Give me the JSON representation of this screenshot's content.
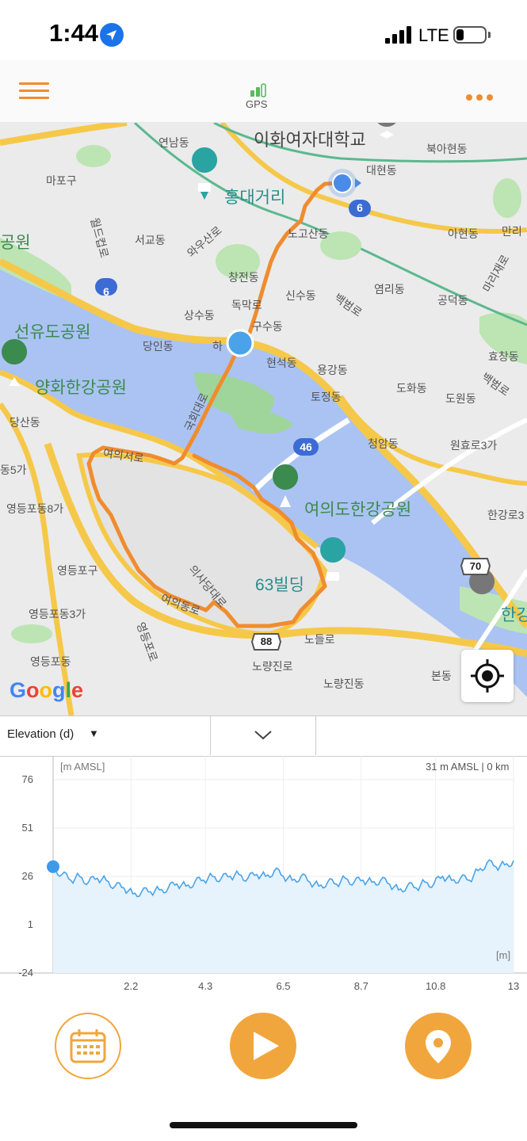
{
  "status_bar": {
    "time": "1:44",
    "network": "LTE",
    "icons": [
      "location-arrow-icon",
      "signal-icon",
      "battery-icon"
    ]
  },
  "toolbar": {
    "gps_label": "GPS",
    "icons": [
      "hamburger-menu-icon",
      "gps-signal-icon",
      "more-options-icon"
    ]
  },
  "map": {
    "labels": [
      {
        "id": "yeonhui",
        "text": "연남동"
      },
      {
        "id": "ewha",
        "text": "이화여자대학교"
      },
      {
        "id": "bukahyeon",
        "text": "북아현동"
      },
      {
        "id": "mapogu",
        "text": "마포구"
      },
      {
        "id": "hongdae",
        "text": "홍대거리"
      },
      {
        "id": "daehyeon",
        "text": "대현동"
      },
      {
        "id": "park1",
        "text": "공원"
      },
      {
        "id": "seogyo",
        "text": "서교동"
      },
      {
        "id": "wausan",
        "text": "와우산로"
      },
      {
        "id": "nogosan",
        "text": "노고산동"
      },
      {
        "id": "ahyeon",
        "text": "아현동"
      },
      {
        "id": "malli",
        "text": "만리"
      },
      {
        "id": "worldcup",
        "text": "월드컵로"
      },
      {
        "id": "changjeon",
        "text": "창전동"
      },
      {
        "id": "yeomni",
        "text": "염리동"
      },
      {
        "id": "mallijae",
        "text": "마리재로"
      },
      {
        "id": "sinsu",
        "text": "신수동"
      },
      {
        "id": "baekbeom1",
        "text": "백범로"
      },
      {
        "id": "gongdeok",
        "text": "공덕동"
      },
      {
        "id": "dongmak",
        "text": "독막로"
      },
      {
        "id": "sangsu",
        "text": "상수동"
      },
      {
        "id": "seonyudo",
        "text": "선유도공원"
      },
      {
        "id": "gusu",
        "text": "구수동"
      },
      {
        "id": "danginro",
        "text": "당인동"
      },
      {
        "id": "ha",
        "text": "하"
      },
      {
        "id": "hyoseok",
        "text": "현석동"
      },
      {
        "id": "yonggang",
        "text": "용강동"
      },
      {
        "id": "hyochang",
        "text": "효창동"
      },
      {
        "id": "yanghwa",
        "text": "양화한강공원"
      },
      {
        "id": "baekbeom2",
        "text": "백범로"
      },
      {
        "id": "tojeong",
        "text": "토정동"
      },
      {
        "id": "dohwa",
        "text": "도화동"
      },
      {
        "id": "dangsan",
        "text": "당산동"
      },
      {
        "id": "gukhoe",
        "text": "국회대로"
      },
      {
        "id": "dowon",
        "text": "도원동"
      },
      {
        "id": "cheongam",
        "text": "청암동"
      },
      {
        "id": "yeouiseo",
        "text": "여의서로"
      },
      {
        "id": "wonhyo",
        "text": "원효로3가"
      },
      {
        "id": "dong5",
        "text": "동5가"
      },
      {
        "id": "yeouido",
        "text": "여의도한강공원"
      },
      {
        "id": "yeongdeungpo8",
        "text": "영등포동8가"
      },
      {
        "id": "hanggang3",
        "text": "한강로3"
      },
      {
        "id": "yeongdeungpogu",
        "text": "영등포구"
      },
      {
        "id": "uisadang",
        "text": "의사당대로"
      },
      {
        "id": "63bldg",
        "text": "63빌딩"
      },
      {
        "id": "yeouidongro",
        "text": "여의동로"
      },
      {
        "id": "yeongdeungpo3",
        "text": "영등포동3가"
      },
      {
        "id": "hanggang",
        "text": "한강"
      },
      {
        "id": "yeongdeungporo",
        "text": "영등포로"
      },
      {
        "id": "nodeulro",
        "text": "노들로"
      },
      {
        "id": "yeongdeungpodong",
        "text": "영등포동"
      },
      {
        "id": "noryangjinro",
        "text": "노량진로"
      },
      {
        "id": "bondong",
        "text": "본동"
      },
      {
        "id": "noryangjin",
        "text": "노량진동"
      }
    ],
    "route_badges": [
      "6",
      "6",
      "46",
      "70",
      "88"
    ],
    "google_logo": "Google",
    "route_color": "#f08c2e"
  },
  "selector": {
    "label": "Elevation (d)",
    "dropdown_icon": "▼"
  },
  "chart_data": {
    "type": "area",
    "y_unit_label": "[m AMSL]",
    "x_unit_label": "[m]",
    "current_readout": "31 m AMSL | 0 km",
    "yticks": [
      "76",
      "51",
      "26",
      "1",
      "-24"
    ],
    "xticks": [
      "2.2",
      "4.3",
      "6.5",
      "8.7",
      "10.8",
      "13"
    ],
    "ylim": [
      -24,
      76
    ],
    "xlim": [
      0,
      13
    ],
    "x": [
      0,
      0.25,
      0.5,
      0.75,
      1.0,
      1.25,
      1.5,
      1.75,
      2.0,
      2.25,
      2.5,
      2.75,
      3.0,
      3.25,
      3.5,
      3.75,
      4.0,
      4.25,
      4.5,
      4.75,
      5.0,
      5.25,
      5.5,
      5.75,
      6.0,
      6.25,
      6.5,
      6.75,
      7.0,
      7.25,
      7.5,
      7.75,
      8.0,
      8.25,
      8.5,
      8.75,
      9.0,
      9.25,
      9.5,
      9.75,
      10.0,
      10.25,
      10.5,
      10.75,
      11.0,
      11.25,
      11.5,
      11.75,
      12.0,
      12.25,
      12.5,
      12.75,
      13.0
    ],
    "series": [
      {
        "values": [
          31,
          27,
          24,
          26,
          23,
          25,
          24,
          21,
          20,
          17,
          18,
          18,
          19,
          20,
          22,
          21,
          23,
          24,
          26,
          25,
          26,
          27,
          25,
          27,
          26,
          29,
          26,
          24,
          26,
          23,
          21,
          23,
          22,
          25,
          23,
          24,
          23,
          24,
          22,
          19,
          21,
          20,
          23,
          22,
          26,
          24,
          25,
          24,
          29,
          33,
          31,
          32,
          34
        ]
      }
    ],
    "current_marker_x": 0,
    "colors": {
      "line": "#4aa3e8",
      "fill": "#e6f2fc",
      "marker": "#3d9be9"
    }
  },
  "bottom": {
    "buttons": [
      "calendar-button",
      "play-button",
      "location-pin-button"
    ]
  }
}
